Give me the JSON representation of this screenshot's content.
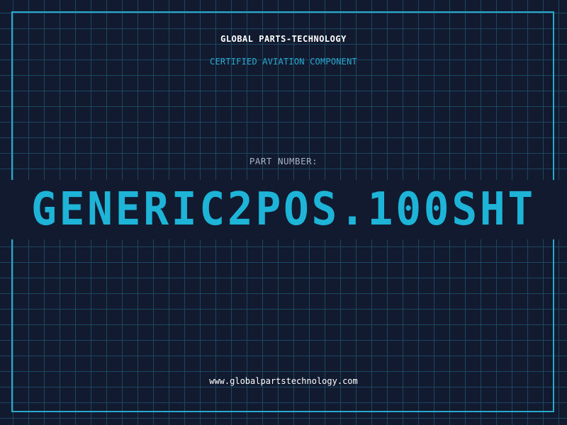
{
  "header": {
    "company_name": "GLOBAL PARTS-TECHNOLOGY",
    "subtitle": "CERTIFIED AVIATION COMPONENT"
  },
  "part": {
    "label": "PART NUMBER:",
    "number": "GENERIC2POS.100SHT"
  },
  "footer": {
    "website": "www.globalpartstechnology.com"
  },
  "colors": {
    "background": "#121a30",
    "grid": "#1d4660",
    "accent": "#2aa9cf",
    "part_number": "#1db4d8",
    "label": "#a7b1c4",
    "text": "#ffffff"
  }
}
